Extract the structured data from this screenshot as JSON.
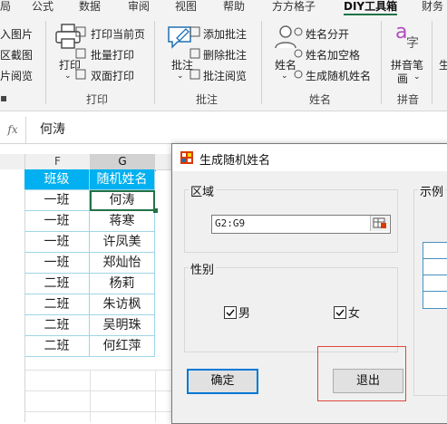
{
  "ribbon_tabs": [
    "局",
    "公式",
    "数据",
    "审阅",
    "视图",
    "帮助",
    "方方格子",
    "DIY工具箱",
    "财务"
  ],
  "ribbon": {
    "left_items": [
      "入图片",
      "区截图",
      "片阅览"
    ],
    "print_group": {
      "big_label": "打印",
      "small": [
        "打印当前页",
        "批量打印",
        "双面打印"
      ],
      "group_label": "打印"
    },
    "annotate_group": {
      "big_label": "批注",
      "small": [
        "添加批注",
        "删除批注",
        "批注阅览"
      ],
      "group_label": "批注"
    },
    "name_group": {
      "big_label": "姓名",
      "small": [
        "姓名分开",
        "姓名加空格",
        "生成随机姓名"
      ],
      "group_label": "姓名"
    },
    "pinyin_group": {
      "big_label_1": "拼音笔",
      "big_label_2": "画",
      "group_label": "拼音",
      "icon_char_a": "a",
      "icon_char_zi": "字"
    },
    "cut_item": "生"
  },
  "formula_bar": {
    "fx": "fx",
    "value": "何涛"
  },
  "columns": [
    "F",
    "G"
  ],
  "table": {
    "headers": [
      "班级",
      "随机姓名"
    ],
    "rows": [
      [
        "一班",
        "何涛"
      ],
      [
        "一班",
        "蒋寒"
      ],
      [
        "一班",
        "许凤美"
      ],
      [
        "一班",
        "郑灿怡"
      ],
      [
        "二班",
        "杨莉"
      ],
      [
        "二班",
        "朱访枫"
      ],
      [
        "二班",
        "吴明珠"
      ],
      [
        "二班",
        "何红萍"
      ]
    ]
  },
  "dialog": {
    "title": "生成随机姓名",
    "region_label": "区域",
    "range_value": "G2:G9",
    "gender_label": "性别",
    "male_label": "男",
    "female_label": "女",
    "male_checked": true,
    "female_checked": true,
    "example_label": "示例",
    "ok_label": "确定",
    "exit_label": "退出"
  },
  "colors": {
    "header_fill": "#00b0f0",
    "accent_green": "#217346",
    "dialog_icon_red": "#d83b01",
    "highlight_red": "#e0463c",
    "ok_border": "#0078d7"
  }
}
